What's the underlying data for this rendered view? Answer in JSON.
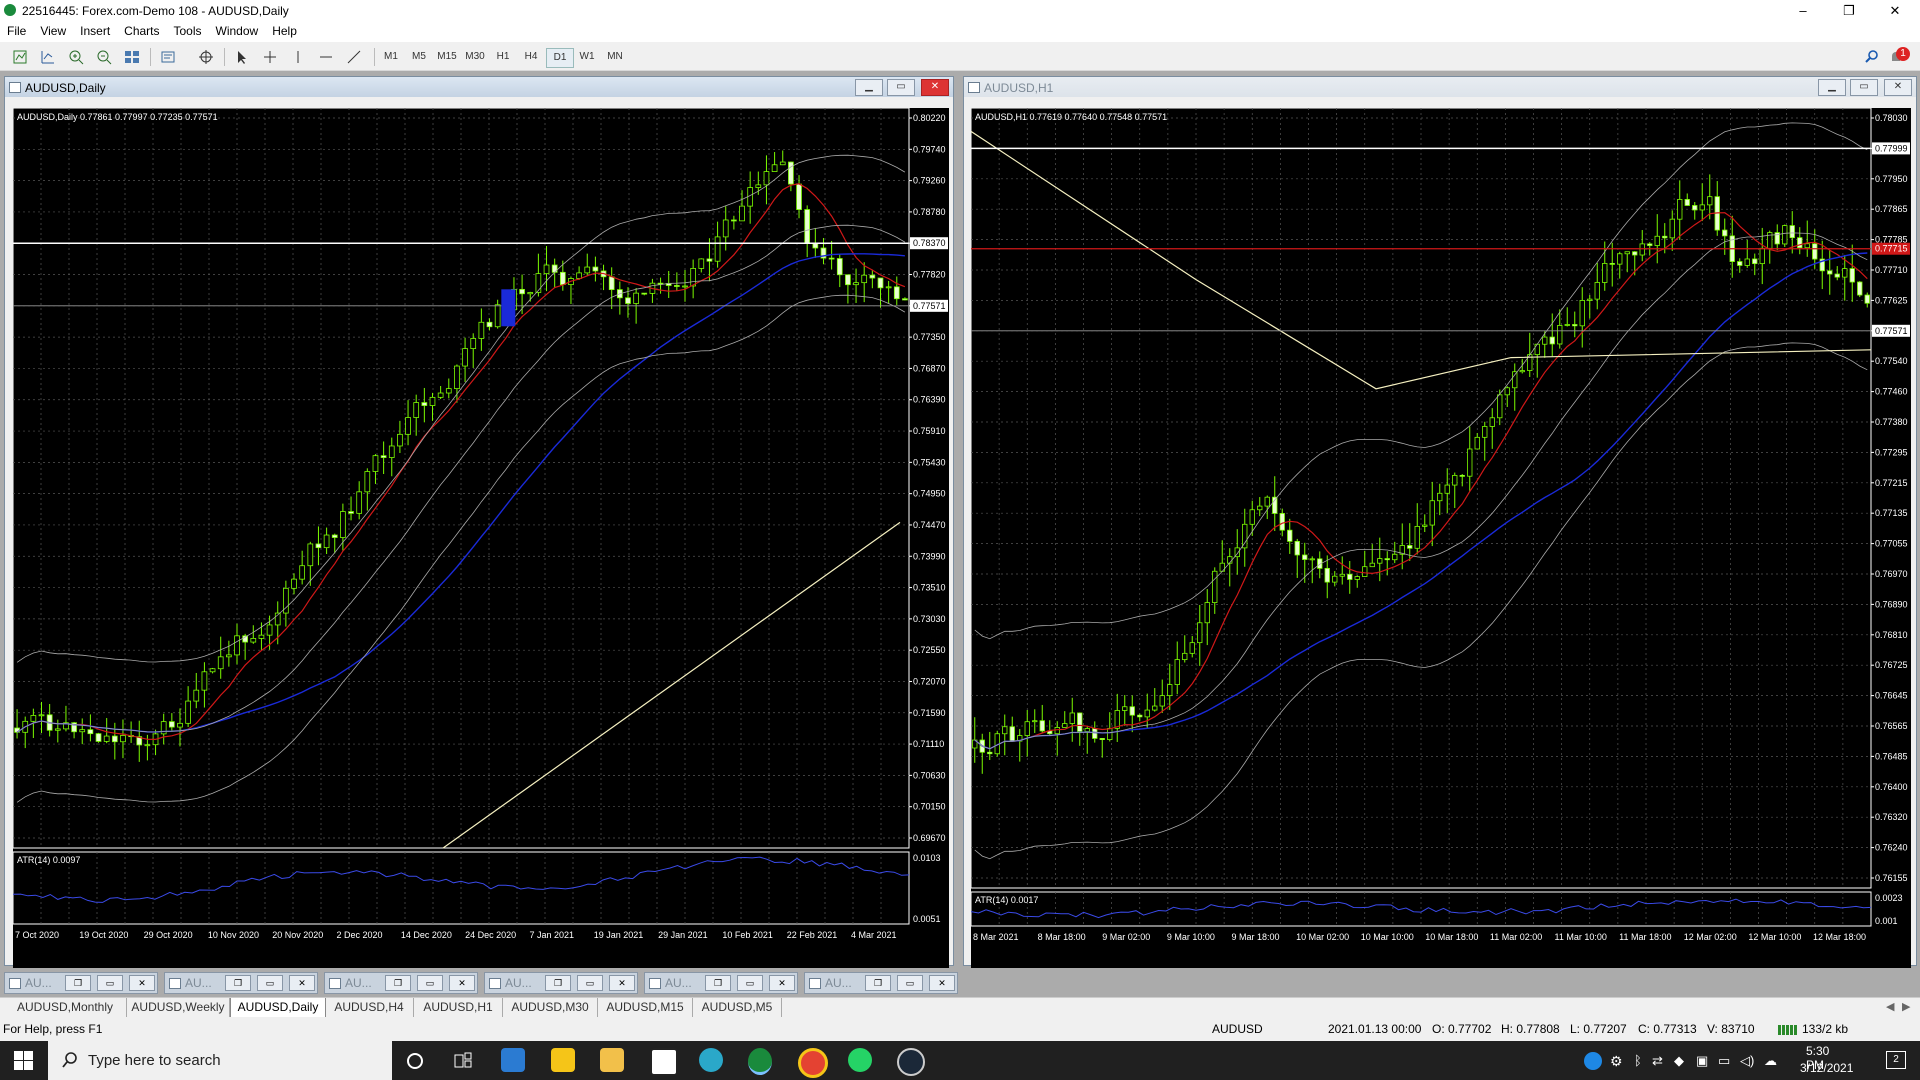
{
  "window": {
    "title": "22516445: Forex.com-Demo 108 - AUDUSD,Daily",
    "minimize": "–",
    "maximize": "❐",
    "close": "✕"
  },
  "menu": [
    "File",
    "View",
    "Insert",
    "Charts",
    "Tools",
    "Window",
    "Help"
  ],
  "toolbar": {
    "timeframes": [
      "M1",
      "M5",
      "M15",
      "M30",
      "H1",
      "H4",
      "D1",
      "W1",
      "MN"
    ],
    "active_timeframe": "D1",
    "notification_count": "1"
  },
  "charts": [
    {
      "window_title": "AUDUSD,Daily",
      "info": "AUDUSD,Daily  0.77861 0.77997 0.77235 0.77571",
      "price_axis": [
        "0.80220",
        "0.79740",
        "0.79260",
        "0.78780",
        "0.78370",
        "0.77820",
        "0.77571",
        "0.77350",
        "0.76870",
        "0.76390",
        "0.75910",
        "0.75430",
        "0.74950",
        "0.74470",
        "0.73990",
        "0.73510",
        "0.73030",
        "0.72550",
        "0.72070",
        "0.71590",
        "0.71110",
        "0.70630",
        "0.70150",
        "0.69670"
      ],
      "level_line_price": "0.78370",
      "last_price": "0.77571",
      "indicator_label": "ATR(14) 0.0097",
      "indicator_axis": [
        "0.0103",
        "0.0051"
      ],
      "time_axis": [
        "7 Oct 2020",
        "19 Oct 2020",
        "29 Oct 2020",
        "10 Nov 2020",
        "20 Nov 2020",
        "2 Dec 2020",
        "14 Dec 2020",
        "24 Dec 2020",
        "7 Jan 2021",
        "19 Jan 2021",
        "29 Jan 2021",
        "10 Feb 2021",
        "22 Feb 2021",
        "4 Mar 2021"
      ]
    },
    {
      "window_title": "AUDUSD,H1",
      "info": "AUDUSD,H1  0.77619 0.77640 0.77548 0.77571",
      "price_axis": [
        "0.78030",
        "0.77999",
        "0.77950",
        "0.77865",
        "0.77785",
        "0.77710",
        "0.77625",
        "0.77571",
        "0.77540",
        "0.77460",
        "0.77380",
        "0.77295",
        "0.77215",
        "0.77135",
        "0.77055",
        "0.76970",
        "0.76890",
        "0.76810",
        "0.76725",
        "0.76645",
        "0.76565",
        "0.76485",
        "0.76400",
        "0.76320",
        "0.76240",
        "0.76155"
      ],
      "level_line_price": "0.77999",
      "red_line_price": "0.77715",
      "last_price": "0.77571",
      "indicator_label": "ATR(14) 0.0017",
      "indicator_axis": [
        "0.0023",
        "0.001"
      ],
      "time_axis": [
        "8 Mar 2021",
        "8 Mar 18:00",
        "9 Mar 02:00",
        "9 Mar 10:00",
        "9 Mar 18:00",
        "10 Mar 02:00",
        "10 Mar 10:00",
        "10 Mar 18:00",
        "11 Mar 02:00",
        "11 Mar 10:00",
        "11 Mar 18:00",
        "12 Mar 02:00",
        "12 Mar 10:00",
        "12 Mar 18:00"
      ]
    }
  ],
  "minimized_windows": [
    "AU...",
    "AU...",
    "AU...",
    "AU...",
    "AU...",
    "AU..."
  ],
  "tabs": [
    "AUDUSD,Monthly",
    "AUDUSD,Weekly",
    "AUDUSD,Daily",
    "AUDUSD,H4",
    "AUDUSD,H1",
    "AUDUSD,M30",
    "AUDUSD,M15",
    "AUDUSD,M5"
  ],
  "active_tab": "AUDUSD,Daily",
  "status": {
    "help": "For Help, press F1",
    "symbol": "AUDUSD",
    "datetime": "2021.01.13 00:00",
    "open": "O: 0.77702",
    "high": "H: 0.77808",
    "low": "L: 0.77207",
    "close": "C: 0.77313",
    "volume": "V: 83710",
    "traffic": "133/2 kb"
  },
  "taskbar": {
    "search_placeholder": "Type here to search",
    "time": "5:30 PM",
    "date": "3/12/2021",
    "notification_count": "2"
  }
}
